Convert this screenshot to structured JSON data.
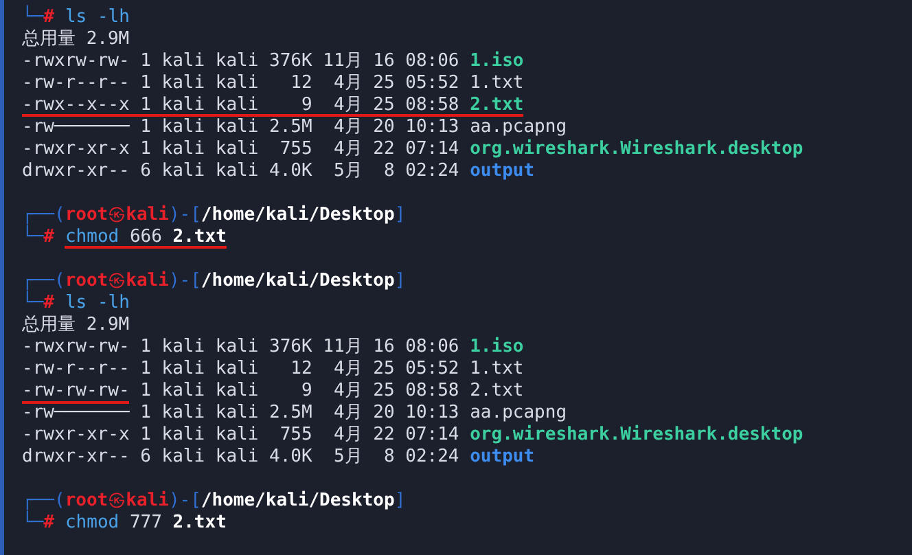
{
  "lines": [
    {
      "kind": "command",
      "corner": "└─",
      "hash": "#",
      "tokens": [
        {
          "kind": "cmd",
          "text": "ls"
        },
        {
          "kind": "cmd",
          "text": "-lh"
        }
      ]
    },
    {
      "kind": "text",
      "text": "总用量 2.9M"
    },
    {
      "kind": "listing",
      "perms": {
        "text": "-rwxrw-rw-",
        "underlined": false
      },
      "meta": " 1 kali kali 376K 11月 16 08:06 ",
      "name": {
        "text": "1.iso",
        "kind": "exec"
      },
      "underlined": false
    },
    {
      "kind": "listing",
      "perms": {
        "text": "-rw-r--r--",
        "underlined": false
      },
      "meta": " 1 kali kali   12  4月 25 05:52 ",
      "name": {
        "text": "1.txt",
        "kind": "file"
      },
      "underlined": false
    },
    {
      "kind": "listing",
      "perms": {
        "text": "-rwx--x--x"
      },
      "meta": " 1 kali kali    9  4月 25 08:58 ",
      "name": {
        "text": "2.txt",
        "kind": "exec"
      },
      "underlined": true
    },
    {
      "kind": "listing",
      "perms": {
        "text": "-rw───────",
        "underlined": false
      },
      "meta": " 1 kali kali 2.5M  4月 20 10:13 ",
      "name": {
        "text": "aa.pcapng",
        "kind": "file"
      },
      "underlined": false
    },
    {
      "kind": "listing",
      "perms": {
        "text": "-rwxr-xr-x",
        "underlined": false
      },
      "meta": " 1 kali kali  755  4月 22 07:14 ",
      "name": {
        "text": "org.wireshark.Wireshark.desktop",
        "kind": "exec"
      },
      "underlined": false
    },
    {
      "kind": "listing",
      "perms": {
        "text": "drwxr-xr--",
        "underlined": false
      },
      "meta": " 6 kali kali 4.0K  5月  8 02:24 ",
      "name": {
        "text": "output",
        "kind": "dir"
      },
      "underlined": false
    },
    {
      "kind": "blank"
    },
    {
      "kind": "prompt",
      "open": "┌──(",
      "user": "root",
      "at": "㉿",
      "host": "kali",
      "mid": ")-[",
      "path": "/home/kali/Desktop",
      "close": "]"
    },
    {
      "kind": "command",
      "corner": "└─",
      "hash": "#",
      "underlined": true,
      "tokens": [
        {
          "kind": "cmd",
          "text": "chmod"
        },
        {
          "kind": "arg",
          "text": "666"
        },
        {
          "kind": "file",
          "text": "2.txt"
        }
      ]
    },
    {
      "kind": "blank"
    },
    {
      "kind": "prompt",
      "open": "┌──(",
      "user": "root",
      "at": "㉿",
      "host": "kali",
      "mid": ")-[",
      "path": "/home/kali/Desktop",
      "close": "]"
    },
    {
      "kind": "command",
      "corner": "└─",
      "hash": "#",
      "underlined": false,
      "tokens": [
        {
          "kind": "cmd",
          "text": "ls"
        },
        {
          "kind": "cmd",
          "text": "-lh"
        }
      ]
    },
    {
      "kind": "text",
      "text": "总用量 2.9M"
    },
    {
      "kind": "listing",
      "perms": {
        "text": "-rwxrw-rw-",
        "underlined": false
      },
      "meta": " 1 kali kali 376K 11月 16 08:06 ",
      "name": {
        "text": "1.iso",
        "kind": "exec"
      },
      "underlined": false
    },
    {
      "kind": "listing",
      "perms": {
        "text": "-rw-r--r--",
        "underlined": false
      },
      "meta": " 1 kali kali   12  4月 25 05:52 ",
      "name": {
        "text": "1.txt",
        "kind": "file"
      },
      "underlined": false
    },
    {
      "kind": "listing",
      "perms": {
        "text": "-rw-rw-rw-",
        "underlined": true
      },
      "meta": " 1 kali kali    9  4月 25 08:58 ",
      "name": {
        "text": "2.txt",
        "kind": "file"
      },
      "underlined": false
    },
    {
      "kind": "listing",
      "perms": {
        "text": "-rw───────",
        "underlined": false
      },
      "meta": " 1 kali kali 2.5M  4月 20 10:13 ",
      "name": {
        "text": "aa.pcapng",
        "kind": "file"
      },
      "underlined": false
    },
    {
      "kind": "listing",
      "perms": {
        "text": "-rwxr-xr-x",
        "underlined": false
      },
      "meta": " 1 kali kali  755  4月 22 07:14 ",
      "name": {
        "text": "org.wireshark.Wireshark.desktop",
        "kind": "exec"
      },
      "underlined": false
    },
    {
      "kind": "listing",
      "perms": {
        "text": "drwxr-xr--",
        "underlined": false
      },
      "meta": " 6 kali kali 4.0K  5月  8 02:24 ",
      "name": {
        "text": "output",
        "kind": "dir"
      },
      "underlined": false
    },
    {
      "kind": "blank"
    },
    {
      "kind": "prompt",
      "open": "┌──(",
      "user": "root",
      "at": "㉿",
      "host": "kali",
      "mid": ")-[",
      "path": "/home/kali/Desktop",
      "close": "]"
    },
    {
      "kind": "command",
      "corner": "└─",
      "hash": "#",
      "underlined": false,
      "tokens": [
        {
          "kind": "cmd",
          "text": "chmod"
        },
        {
          "kind": "arg",
          "text": "777"
        },
        {
          "kind": "file",
          "text": "2.txt"
        }
      ]
    }
  ]
}
